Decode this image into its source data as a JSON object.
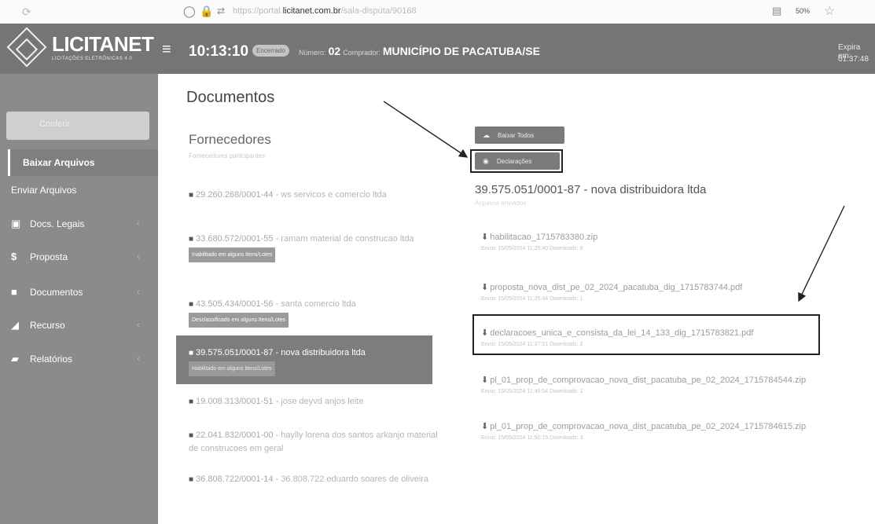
{
  "browser": {
    "url_prefix": "https://portal.",
    "url_domain": "licitanet.com.br",
    "url_path": "/sala-disputa/90168",
    "zoom": "50%"
  },
  "header": {
    "brand": "LICITANET",
    "brand_sub": "LICITAÇÕES ELETRÔNICAS 4.0",
    "clock": "10:13:10",
    "status": "Encerrado",
    "numero_label": "Número:",
    "numero_value": "02",
    "comprador_label": "Comprador:",
    "comprador_value": "MUNICÍPIO DE PACATUBA/SE",
    "expira_label": "Expira em:",
    "expira_time": "01:37:48"
  },
  "sidebar": {
    "top_label": "Conferir",
    "items": [
      {
        "label": "Baixar Arquivos",
        "icon": ""
      },
      {
        "label": "Enviar Arquivos",
        "icon": ""
      },
      {
        "label": "Docs. Legais",
        "icon": "book-icon"
      },
      {
        "label": "Proposta",
        "icon": "dollar-icon"
      },
      {
        "label": "Documentos",
        "icon": "folder-icon"
      },
      {
        "label": "Recurso",
        "icon": "gavel-icon"
      },
      {
        "label": "Relatórios",
        "icon": "folder-open-icon"
      }
    ]
  },
  "content": {
    "title": "Documentos",
    "fornecedores": "Fornecedores",
    "fornecedores_sub": "Fornecedores participantes",
    "suppliers": [
      {
        "cnpj": "29.260.268/0001-44",
        "name": " - ws servicos e comercio ltda",
        "tag": ""
      },
      {
        "cnpj": "33.680.572/0001-55",
        "name": " - ramam material de construcao ltda",
        "tag": "Inabilitado em alguns Itens/Lotes"
      },
      {
        "cnpj": "43.505.434/0001-56",
        "name": " - santa comercio ltda",
        "tag": "Desclassificado em alguns Itens/Lotes"
      },
      {
        "cnpj": "39.575.051/0001-87",
        "name": " - nova distribuidora ltda",
        "tag": "Habilitado em alguns Itens/Lotes"
      },
      {
        "cnpj": "19.008.313/0001-51",
        "name": " - jose deyvd anjos leite",
        "tag": ""
      },
      {
        "cnpj": "22.041.832/0001-00",
        "name": " - haylly lorena dos santos arkanjo material de construcoes em geral",
        "tag": ""
      },
      {
        "cnpj": "36.808.722/0001-14",
        "name": " - 36.808.722 eduardo soares de oliveira",
        "tag": ""
      }
    ],
    "btn_baixar_todos": "Baixar Todos",
    "btn_declaracoes": "Declarações",
    "selected_title": "39.575.051/0001-87 - nova distribuidora ltda",
    "selected_sub": "Arquivos enviados",
    "files": [
      {
        "name": "habilitacao_1715783380.zip",
        "meta": "Envio: 15/05/2024 11:29:40 Downloads: 6"
      },
      {
        "name": "proposta_nova_dist_pe_02_2024_pacatuba_dig_1715783744.pdf",
        "meta": "Envio: 15/05/2024 11:35:44 Downloads: 1"
      },
      {
        "name": "declaracoes_unica_e_consista_da_lei_14_133_dig_1715783821.pdf",
        "meta": "Envio: 15/05/2024 11:37:01 Downloads: 2"
      },
      {
        "name": "pl_01_prop_de_comprovacao_nova_dist_pacatuba_pe_02_2024_1715784544.zip",
        "meta": "Envio: 15/05/2024 11:49:04 Downloads: 1"
      },
      {
        "name": "pl_01_prop_de_comprovacao_nova_dist_pacatuba_pe_02_2024_1715784615.zip",
        "meta": "Envio: 15/05/2024 11:50:15 Downloads: 3"
      }
    ]
  }
}
